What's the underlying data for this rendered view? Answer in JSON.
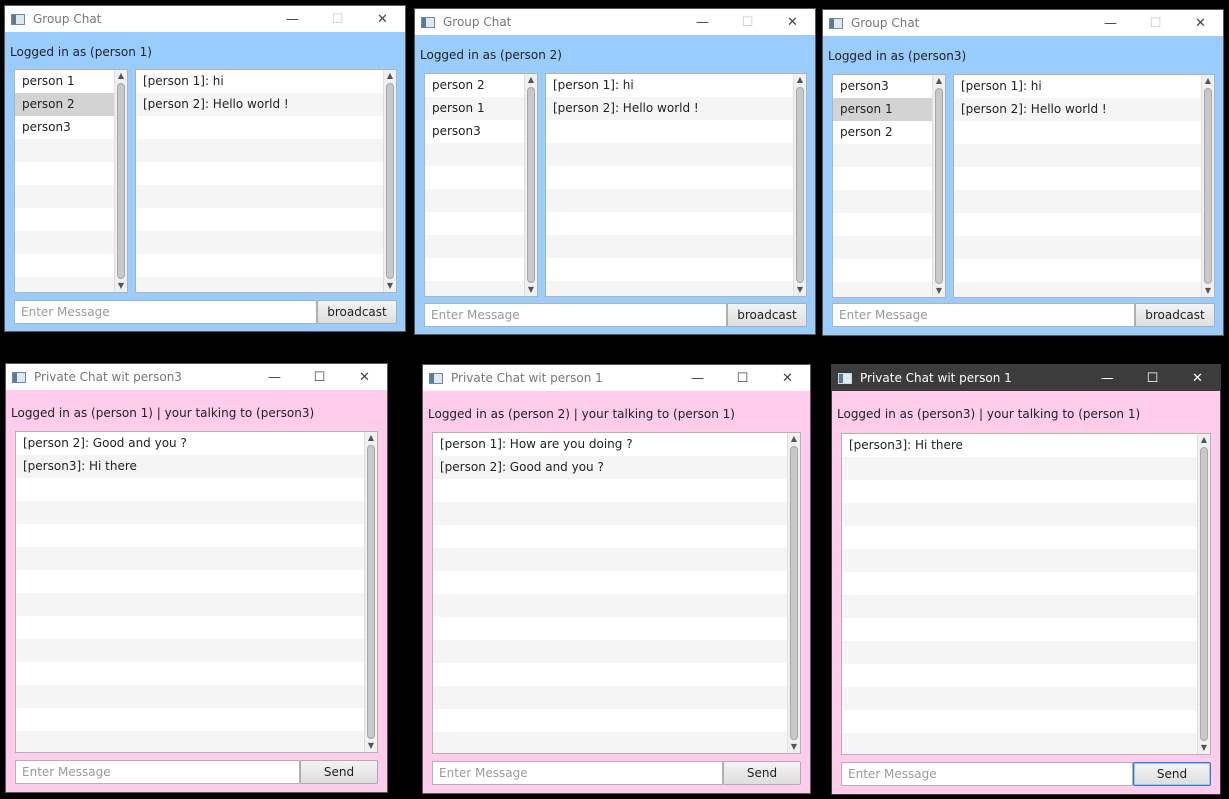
{
  "colors": {
    "group_bg": "#99ccff",
    "private_bg": "#ffcceb",
    "selected_row": "#d3d3d3",
    "focus_border": "#2a7ad6"
  },
  "icons": {
    "app": "javafx-app-icon",
    "minimize": "minimize-icon",
    "maximize": "maximize-icon",
    "close": "close-icon"
  },
  "group_chat_1": {
    "title": "Group Chat",
    "status": "Logged in as (person 1)",
    "users": [
      "person 1",
      "person 2",
      "person3"
    ],
    "selected_user": "person 2",
    "messages": [
      "[person 1]: hi",
      "[person 2]: Hello world !"
    ],
    "input_placeholder": "Enter Message",
    "button_label": "broadcast"
  },
  "group_chat_2": {
    "title": "Group Chat",
    "status": "Logged in as (person 2)",
    "users": [
      "person 2",
      "person 1",
      "person3"
    ],
    "messages": [
      "[person 1]: hi",
      "[person 2]: Hello world !"
    ],
    "input_placeholder": "Enter Message",
    "button_label": "broadcast"
  },
  "group_chat_3": {
    "title": "Group Chat",
    "status": "Logged in as (person3)",
    "users": [
      "person3",
      "person 1",
      "person 2"
    ],
    "selected_user": "person 1",
    "messages": [
      "[person 1]: hi",
      "[person 2]: Hello world !"
    ],
    "input_placeholder": "Enter Message",
    "button_label": "broadcast"
  },
  "private_chat_1": {
    "title": "Private Chat wit person3",
    "status": "Logged in as (person 1) | your talking to (person3)",
    "messages": [
      "[person 2]: Good and you ?",
      "[person3]: Hi there"
    ],
    "input_placeholder": "Enter Message",
    "button_label": "Send"
  },
  "private_chat_2": {
    "title": "Private Chat wit person 1",
    "status": "Logged in as (person 2) | your talking to (person 1)",
    "messages": [
      "[person 1]: How are you doing ?",
      "[person 2]: Good and you ?"
    ],
    "input_placeholder": "Enter Message",
    "button_label": "Send"
  },
  "private_chat_3": {
    "title": "Private Chat wit person 1",
    "status": "Logged in as (person3) | your talking to (person 1)",
    "messages": [
      "[person3]: Hi there"
    ],
    "input_placeholder": "Enter Message",
    "button_label": "Send"
  }
}
